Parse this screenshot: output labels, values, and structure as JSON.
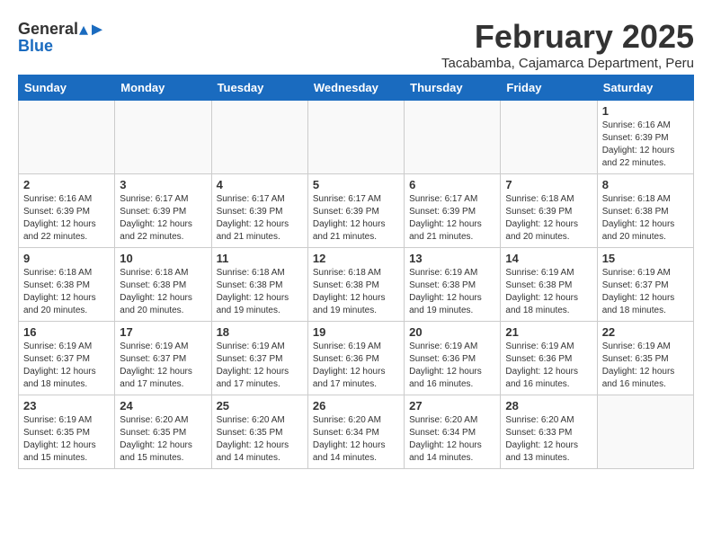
{
  "logo": {
    "general": "General",
    "blue": "Blue"
  },
  "title": "February 2025",
  "subtitle": "Tacabamba, Cajamarca Department, Peru",
  "weekdays": [
    "Sunday",
    "Monday",
    "Tuesday",
    "Wednesday",
    "Thursday",
    "Friday",
    "Saturday"
  ],
  "weeks": [
    [
      {
        "day": "",
        "info": ""
      },
      {
        "day": "",
        "info": ""
      },
      {
        "day": "",
        "info": ""
      },
      {
        "day": "",
        "info": ""
      },
      {
        "day": "",
        "info": ""
      },
      {
        "day": "",
        "info": ""
      },
      {
        "day": "1",
        "info": "Sunrise: 6:16 AM\nSunset: 6:39 PM\nDaylight: 12 hours\nand 22 minutes."
      }
    ],
    [
      {
        "day": "2",
        "info": "Sunrise: 6:16 AM\nSunset: 6:39 PM\nDaylight: 12 hours\nand 22 minutes."
      },
      {
        "day": "3",
        "info": "Sunrise: 6:17 AM\nSunset: 6:39 PM\nDaylight: 12 hours\nand 22 minutes."
      },
      {
        "day": "4",
        "info": "Sunrise: 6:17 AM\nSunset: 6:39 PM\nDaylight: 12 hours\nand 21 minutes."
      },
      {
        "day": "5",
        "info": "Sunrise: 6:17 AM\nSunset: 6:39 PM\nDaylight: 12 hours\nand 21 minutes."
      },
      {
        "day": "6",
        "info": "Sunrise: 6:17 AM\nSunset: 6:39 PM\nDaylight: 12 hours\nand 21 minutes."
      },
      {
        "day": "7",
        "info": "Sunrise: 6:18 AM\nSunset: 6:39 PM\nDaylight: 12 hours\nand 20 minutes."
      },
      {
        "day": "8",
        "info": "Sunrise: 6:18 AM\nSunset: 6:38 PM\nDaylight: 12 hours\nand 20 minutes."
      }
    ],
    [
      {
        "day": "9",
        "info": "Sunrise: 6:18 AM\nSunset: 6:38 PM\nDaylight: 12 hours\nand 20 minutes."
      },
      {
        "day": "10",
        "info": "Sunrise: 6:18 AM\nSunset: 6:38 PM\nDaylight: 12 hours\nand 20 minutes."
      },
      {
        "day": "11",
        "info": "Sunrise: 6:18 AM\nSunset: 6:38 PM\nDaylight: 12 hours\nand 19 minutes."
      },
      {
        "day": "12",
        "info": "Sunrise: 6:18 AM\nSunset: 6:38 PM\nDaylight: 12 hours\nand 19 minutes."
      },
      {
        "day": "13",
        "info": "Sunrise: 6:19 AM\nSunset: 6:38 PM\nDaylight: 12 hours\nand 19 minutes."
      },
      {
        "day": "14",
        "info": "Sunrise: 6:19 AM\nSunset: 6:38 PM\nDaylight: 12 hours\nand 18 minutes."
      },
      {
        "day": "15",
        "info": "Sunrise: 6:19 AM\nSunset: 6:37 PM\nDaylight: 12 hours\nand 18 minutes."
      }
    ],
    [
      {
        "day": "16",
        "info": "Sunrise: 6:19 AM\nSunset: 6:37 PM\nDaylight: 12 hours\nand 18 minutes."
      },
      {
        "day": "17",
        "info": "Sunrise: 6:19 AM\nSunset: 6:37 PM\nDaylight: 12 hours\nand 17 minutes."
      },
      {
        "day": "18",
        "info": "Sunrise: 6:19 AM\nSunset: 6:37 PM\nDaylight: 12 hours\nand 17 minutes."
      },
      {
        "day": "19",
        "info": "Sunrise: 6:19 AM\nSunset: 6:36 PM\nDaylight: 12 hours\nand 17 minutes."
      },
      {
        "day": "20",
        "info": "Sunrise: 6:19 AM\nSunset: 6:36 PM\nDaylight: 12 hours\nand 16 minutes."
      },
      {
        "day": "21",
        "info": "Sunrise: 6:19 AM\nSunset: 6:36 PM\nDaylight: 12 hours\nand 16 minutes."
      },
      {
        "day": "22",
        "info": "Sunrise: 6:19 AM\nSunset: 6:35 PM\nDaylight: 12 hours\nand 16 minutes."
      }
    ],
    [
      {
        "day": "23",
        "info": "Sunrise: 6:19 AM\nSunset: 6:35 PM\nDaylight: 12 hours\nand 15 minutes."
      },
      {
        "day": "24",
        "info": "Sunrise: 6:20 AM\nSunset: 6:35 PM\nDaylight: 12 hours\nand 15 minutes."
      },
      {
        "day": "25",
        "info": "Sunrise: 6:20 AM\nSunset: 6:35 PM\nDaylight: 12 hours\nand 14 minutes."
      },
      {
        "day": "26",
        "info": "Sunrise: 6:20 AM\nSunset: 6:34 PM\nDaylight: 12 hours\nand 14 minutes."
      },
      {
        "day": "27",
        "info": "Sunrise: 6:20 AM\nSunset: 6:34 PM\nDaylight: 12 hours\nand 14 minutes."
      },
      {
        "day": "28",
        "info": "Sunrise: 6:20 AM\nSunset: 6:33 PM\nDaylight: 12 hours\nand 13 minutes."
      },
      {
        "day": "",
        "info": ""
      }
    ]
  ]
}
